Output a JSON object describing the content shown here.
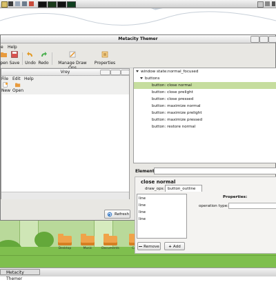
{
  "window": {
    "title": "Metacity Themer"
  },
  "menubar": {
    "items": [
      "e",
      "Help"
    ]
  },
  "toolbar": {
    "buttons": [
      {
        "label": "pen",
        "icon": "open-icon"
      },
      {
        "label": "Save",
        "icon": "save-icon"
      },
      {
        "label": "Undo",
        "icon": "undo-icon"
      },
      {
        "label": "Redo",
        "icon": "redo-icon"
      },
      {
        "label": "Manage Draw Ops",
        "icon": "draw-ops-icon"
      },
      {
        "label": "Properties",
        "icon": "properties-icon"
      }
    ]
  },
  "preview": {
    "title": "Vrey",
    "menu": [
      "File",
      "Edit",
      "Help"
    ],
    "toolbar": [
      {
        "label": "New",
        "icon": "new-icon"
      },
      {
        "label": "Open",
        "icon": "open-folder-icon"
      }
    ],
    "refresh_label": "Refresh"
  },
  "tree": {
    "rows": [
      {
        "label": "window state:normal_focused",
        "level": 0,
        "expanded": true,
        "selected": false
      },
      {
        "label": "buttons",
        "level": 1,
        "expanded": true,
        "selected": false
      },
      {
        "label": "button: close normal",
        "level": 2,
        "selected": true
      },
      {
        "label": "button: close prelight",
        "level": 2,
        "selected": false
      },
      {
        "label": "button: close pressed",
        "level": 2,
        "selected": false
      },
      {
        "label": "button: maximize normal",
        "level": 2,
        "selected": false
      },
      {
        "label": "button: maximize prelight",
        "level": 2,
        "selected": false
      },
      {
        "label": "button: maximize pressed",
        "level": 2,
        "selected": false
      },
      {
        "label": "button: restore normal",
        "level": 2,
        "selected": false
      }
    ]
  },
  "element": {
    "label": "Element:",
    "value": "",
    "title": "close normal",
    "draw_ops_label": "draw_ops:",
    "draw_ops_value": "button_outline",
    "lines": [
      "line",
      "line",
      "line",
      "line"
    ],
    "properties_label": "Properties:",
    "operation_type_label": "operation type:",
    "operation_type_value": "",
    "remove_label": "Remove",
    "add_label": "Add"
  },
  "desktop": {
    "icons": [
      "Desktop",
      "Music",
      "Documents",
      "CAVE"
    ]
  },
  "taskbar": {
    "task_label": "Metacity Themer"
  },
  "colors": {
    "selection": "#c6dd9e",
    "ground": "#b9d99a",
    "bush": "#64a83a"
  }
}
